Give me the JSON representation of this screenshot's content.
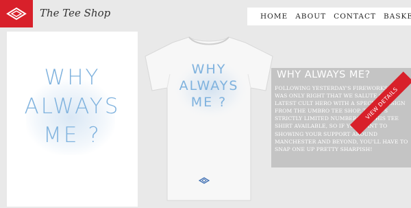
{
  "header": {
    "shop_name": "The Tee Shop",
    "logo_icon": "umbro-diamond-icon",
    "brand_color": "#d8202a"
  },
  "nav": {
    "items": [
      "HOME",
      "ABOUT",
      "CONTACT",
      "BASKET"
    ]
  },
  "poster": {
    "lines": [
      "WHY",
      "ALWAYS",
      "ME ?"
    ],
    "text_color": "#7fb2de"
  },
  "shirt": {
    "lines": [
      "WHY",
      "ALWAYS",
      "ME ?"
    ],
    "badge_icon": "umbro-diamond-icon"
  },
  "product": {
    "title": "WHY ALWAYS ME?",
    "description": "Following yesterday's fireworks, it was only right that we salute City's latest cult hero with a special design from the Umbro Tee Shop. There's strictly limited numbers of this tee shirt available, so if you want to showing your support around Manchester and beyond, you'll have to snap one up pretty sharpish!",
    "view_details_label": "VIEW DETAILS"
  }
}
